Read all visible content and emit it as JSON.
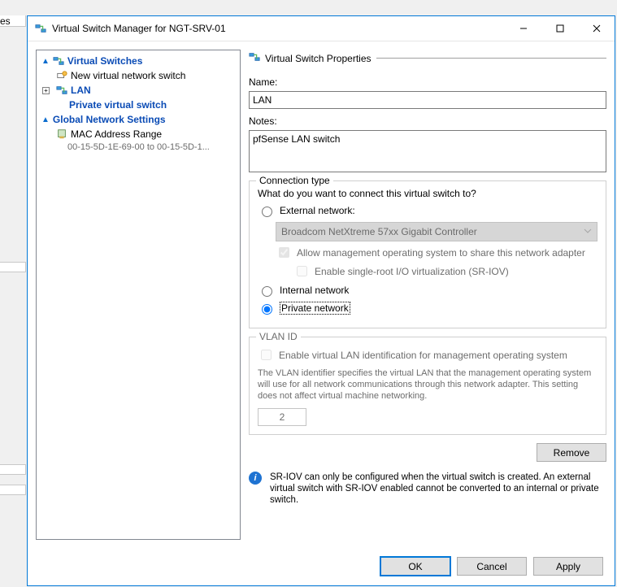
{
  "window": {
    "title": "Virtual Switch Manager for NGT-SRV-01"
  },
  "tree": {
    "section_switches": "Virtual Switches",
    "new_switch": "New virtual network switch",
    "lan": "LAN",
    "lan_sub": "Private virtual switch",
    "section_global": "Global Network Settings",
    "mac_range": "MAC Address Range",
    "mac_range_sub": "00-15-5D-1E-69-00 to 00-15-5D-1..."
  },
  "panel": {
    "header": "Virtual Switch Properties",
    "name_label": "Name:",
    "name_value": "LAN",
    "notes_label": "Notes:",
    "notes_value": "pfSense LAN switch",
    "conn": {
      "legend": "Connection type",
      "question": "What do you want to connect this virtual switch to?",
      "external": "External network:",
      "adapter": "Broadcom NetXtreme 57xx Gigabit Controller",
      "allow_mgmt": "Allow management operating system to share this network adapter",
      "sriov": "Enable single-root I/O virtualization (SR-IOV)",
      "internal": "Internal network",
      "private": "Private network"
    },
    "vlan": {
      "legend": "VLAN ID",
      "enable": "Enable virtual LAN identification for management operating system",
      "help": "The VLAN identifier specifies the virtual LAN that the management operating system will use for all network communications through this network adapter. This setting does not affect virtual machine networking.",
      "value": "2"
    },
    "remove": "Remove",
    "info": "SR-IOV can only be configured when the virtual switch is created. An external virtual switch with SR-IOV enabled cannot be converted to an internal or private switch."
  },
  "footer": {
    "ok": "OK",
    "cancel": "Cancel",
    "apply": "Apply"
  }
}
